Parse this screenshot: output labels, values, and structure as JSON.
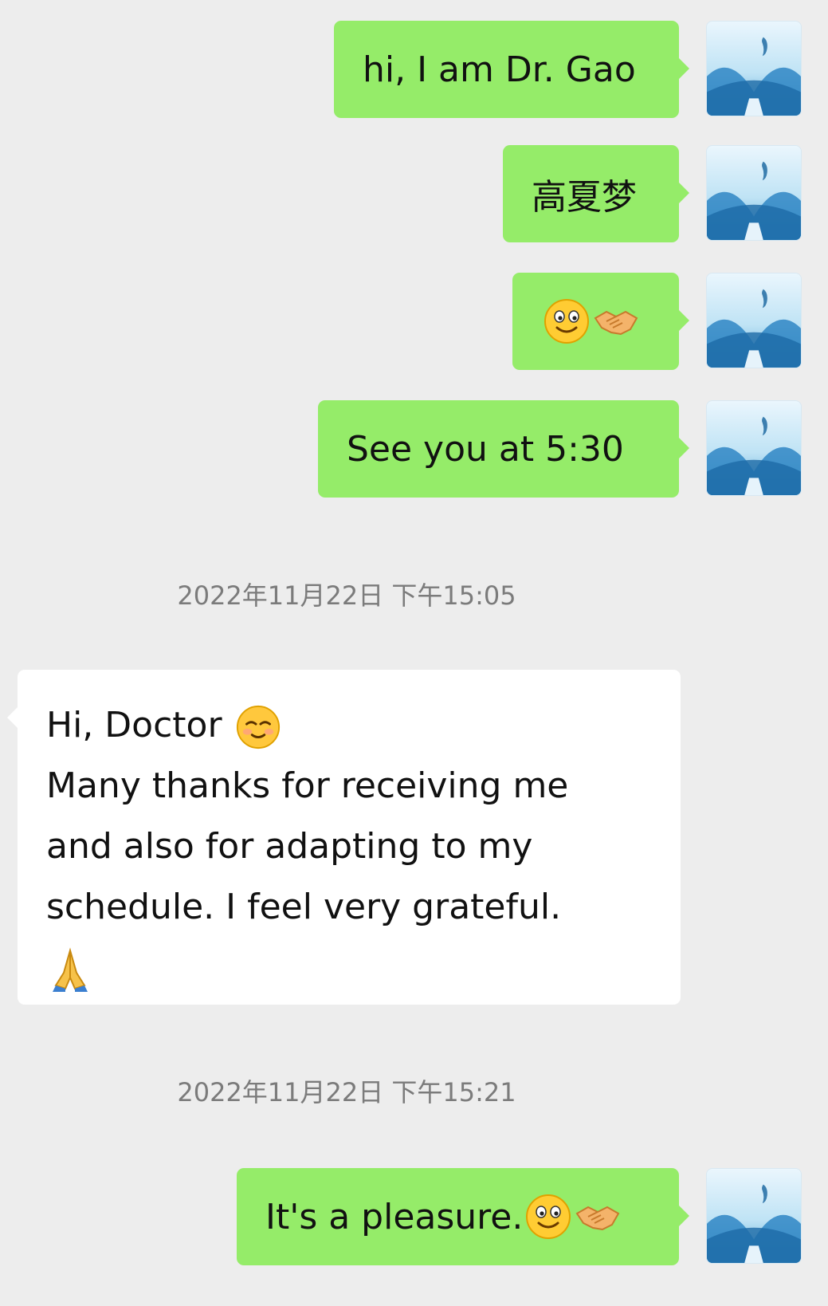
{
  "conversation": {
    "messages": [
      {
        "side": "outgoing",
        "text": "hi, I am Dr. Gao"
      },
      {
        "side": "outgoing",
        "text": "高夏梦"
      },
      {
        "side": "outgoing",
        "text": "",
        "emoji": [
          "smile-icon",
          "handshake-icon"
        ]
      },
      {
        "side": "outgoing",
        "text": "See you at 5:30"
      },
      {
        "side": "timestamp",
        "text": "2022年11月22日 下午15:05"
      },
      {
        "side": "incoming",
        "lines": [
          "Hi, Doctor",
          "Many thanks for receiving me",
          "and also for adapting to my",
          "schedule. I feel very grateful."
        ],
        "emoji": [
          "smiling-blush-icon",
          "folded-hands-icon"
        ]
      },
      {
        "side": "timestamp",
        "text": "2022年11月22日 下午15:21"
      },
      {
        "side": "outgoing",
        "text": "It's a pleasure.",
        "emoji": [
          "smile-icon",
          "handshake-icon"
        ]
      }
    ]
  },
  "colors": {
    "background": "#ededed",
    "outgoing_bubble": "#95ec69",
    "incoming_bubble": "#ffffff",
    "timestamp_text": "#7b7b7b"
  },
  "avatar": {
    "icon": "dolphin-avatar-icon"
  }
}
